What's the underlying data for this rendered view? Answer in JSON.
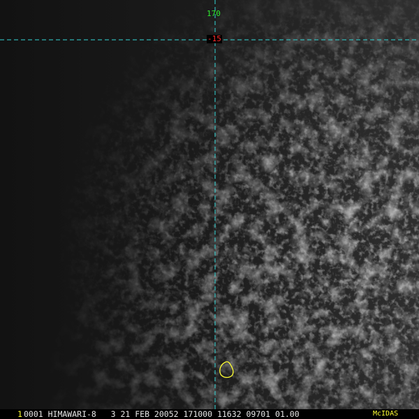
{
  "image": {
    "description_colors": {
      "grid_line": "#33d6d6",
      "coast": "#ffff33",
      "lon_label": "#2ee82e",
      "lat_label": "#ff2a2a",
      "status_text": "#e6e6e6",
      "frame_text": "#ffff33"
    }
  },
  "grid": {
    "longitude_label": "170",
    "latitude_label": "-15"
  },
  "status_bar": {
    "frame_number": "1",
    "info": "0001 HIMAWARI-8   3 21 FEB 20052 171000 11632 09701 01.00",
    "brand": "McIDAS"
  }
}
